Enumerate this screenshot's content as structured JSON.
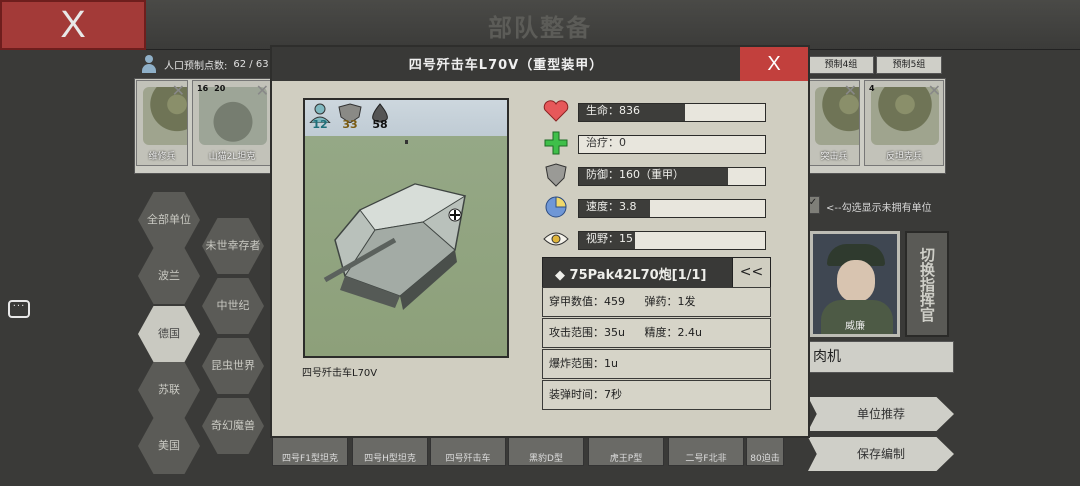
{
  "screen": {
    "close_label": "X",
    "title": "部队整备",
    "population": {
      "label": "人口预制点数:",
      "value": "62 / 63"
    },
    "groups": [
      "预制4组",
      "预制5组"
    ],
    "deck_units": [
      {
        "name": "维修兵",
        "kind": "soldier"
      },
      {
        "name": "山猫2L坦克",
        "kind": "tank",
        "badges": [
          "16",
          "20"
        ]
      },
      {
        "name": "突击兵",
        "kind": "soldier"
      },
      {
        "name": "反坦克兵",
        "kind": "soldier",
        "badges": [
          "4"
        ]
      }
    ],
    "factions": [
      "全部单位",
      "未世幸存者",
      "波兰",
      "中世纪",
      "德国",
      "昆虫世界",
      "苏联",
      "奇幻魔兽",
      "美国"
    ],
    "show_unowned": "<--勾选显示未拥有单位",
    "commander": {
      "name": "威廉",
      "switch_label": "切换指挥官",
      "unit_name": "肉机"
    },
    "recommend_label": "单位推荐",
    "save_label": "保存编制",
    "bottom_units": [
      "四号F1型坦克",
      "四号H型坦克",
      "四号歼击车",
      "黑豹D型",
      "虎王P型",
      "二号F北非",
      "80迫击"
    ]
  },
  "modal": {
    "title": "四号歼击车L70V（重型装甲）",
    "close_label": "X",
    "badges": {
      "population": "12",
      "armor": "33",
      "fuel": "58"
    },
    "caption": "四号歼击车L70V",
    "stats": [
      {
        "icon": "heart-icon",
        "label": "生命：836",
        "fill": 0.57
      },
      {
        "icon": "plus-icon",
        "label": "治疗：0",
        "fill": 0
      },
      {
        "icon": "shield-icon",
        "label": "防御：160（重甲）",
        "fill": 0.8
      },
      {
        "icon": "speed-icon",
        "label": "速度：3.8",
        "fill": 0.38
      },
      {
        "icon": "eye-icon",
        "label": "视野：15",
        "fill": 0.3
      }
    ],
    "weapon": {
      "name": "◆ 75Pak42L70炮[1/1]",
      "collapse_label": "<<",
      "rows": [
        [
          "穿甲数值：459",
          "弹药：1发"
        ],
        [
          "攻击范围：35u",
          "精度：2.4u"
        ],
        [
          "爆炸范围：1u"
        ],
        [
          "装弹时间：7秒"
        ]
      ]
    }
  },
  "colors": {
    "close_red": "#c2403d",
    "panel": "#d0cec1",
    "dark": "#393937"
  }
}
